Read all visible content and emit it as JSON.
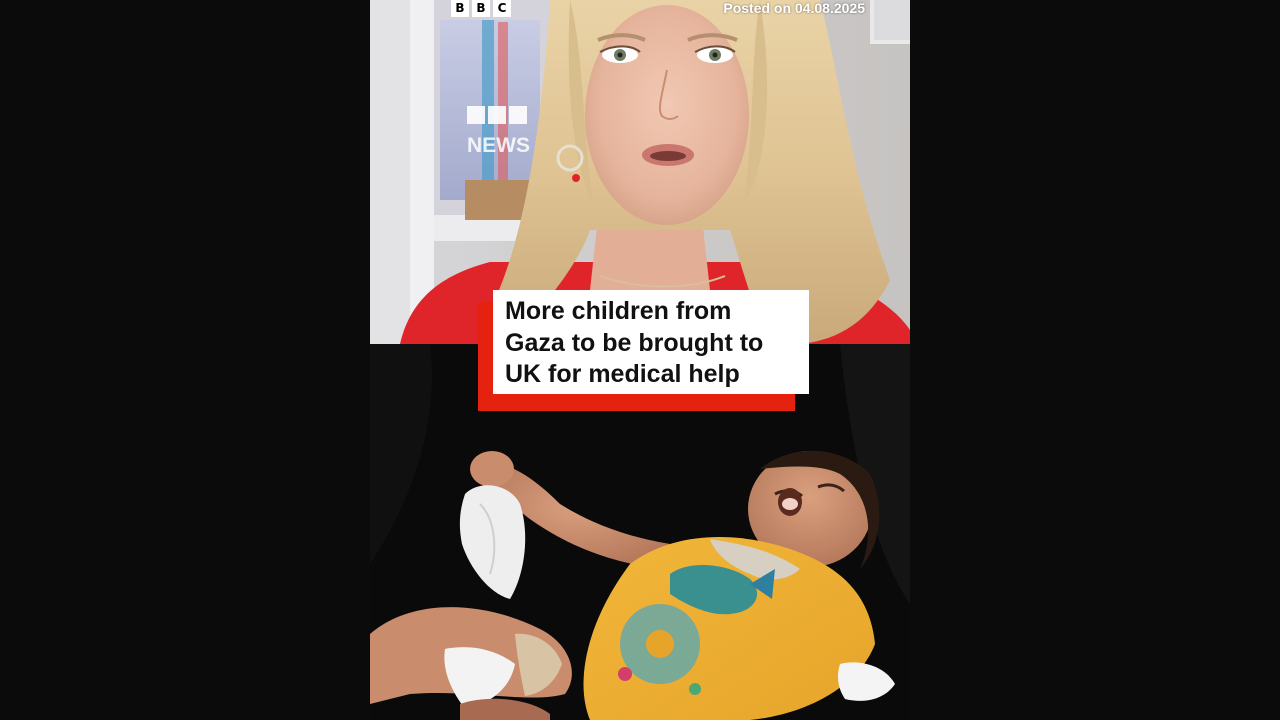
{
  "branding": {
    "logo_letters": [
      "B",
      "B",
      "C"
    ],
    "logo_label": "BBC"
  },
  "posted_label": "Posted on 04.08.2025",
  "headline": {
    "line1": "More children from",
    "line2": "Gaza to be brought to",
    "line3": "UK for medical help"
  },
  "backdrop_text": {
    "bbc_news": "BBC NEWS"
  },
  "colors": {
    "accent_red": "#e5210f",
    "caption_bg": "#ffffff",
    "page_bg": "#0b0b0b"
  }
}
